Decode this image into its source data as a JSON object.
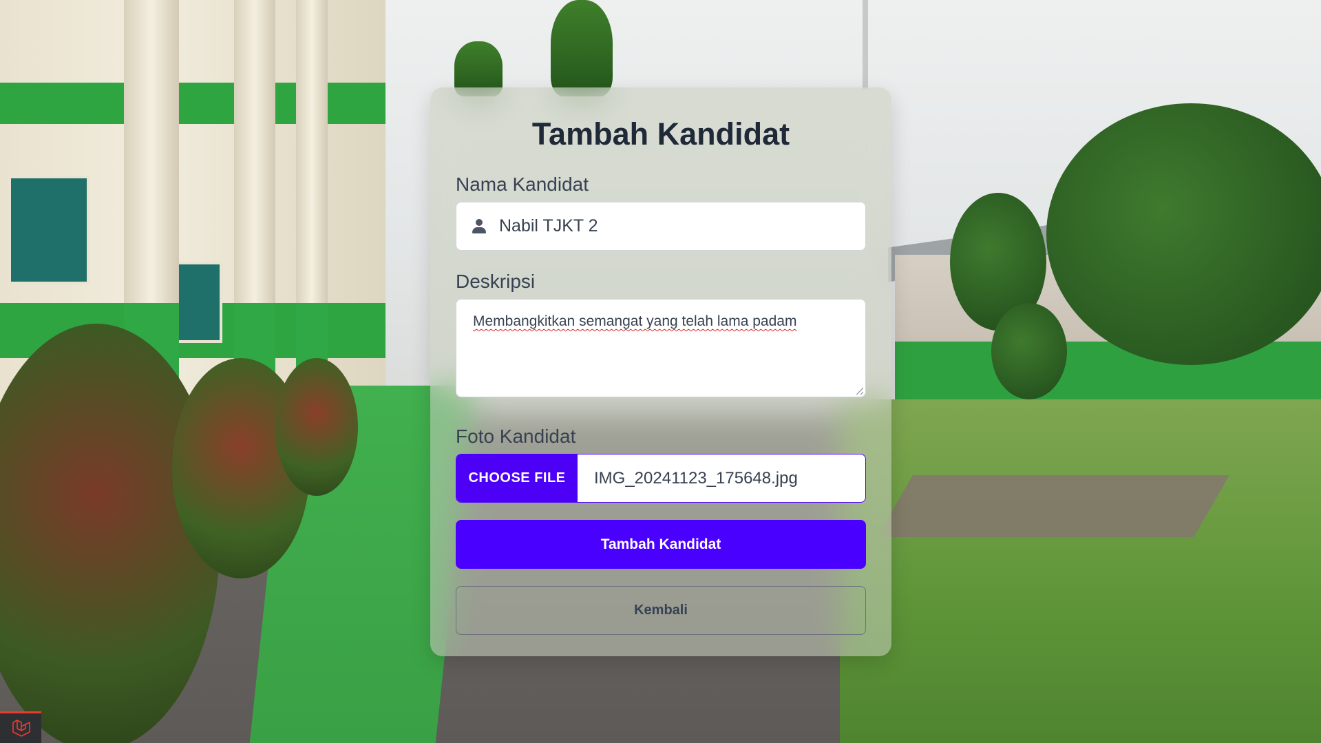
{
  "form": {
    "title": "Tambah Kandidat",
    "name_label": "Nama Kandidat",
    "name_value": "Nabil TJKT 2",
    "description_label": "Deskripsi",
    "description_value": "Membangkitkan semangat yang telah lama padam",
    "photo_label": "Foto Kandidat",
    "choose_file_label": "CHOOSE FILE",
    "file_name": "IMG_20241123_175648.jpg",
    "submit_label": "Tambah Kandidat",
    "back_label": "Kembali"
  },
  "colors": {
    "primary": "#4a00ff",
    "card_bg": "rgba(200,205,190,0.55)",
    "title_text": "#1f2937",
    "laravel_red": "#ef3b2d"
  },
  "icons": {
    "name_field_icon": "person-icon",
    "dev_badge_icon": "laravel-logo-icon"
  }
}
